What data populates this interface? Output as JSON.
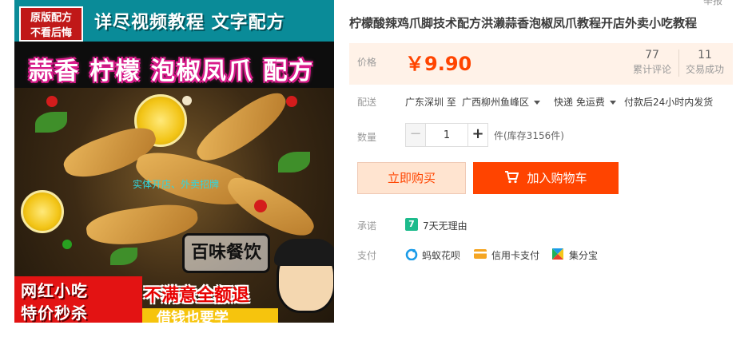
{
  "product_image": {
    "badge_line1": "原版配方",
    "badge_line2": "不看后悔",
    "headline": "详尽视频教程 文字配方",
    "banner": "蒜香 柠檬 泡椒凤爪 配方",
    "watermark": "实体开店、外卖招牌",
    "logo_text": "百味餐饮",
    "bottom_left_line1": "网红小吃",
    "bottom_left_line2": "特价秒杀",
    "bottom_right": "不满意全额退",
    "bottom_strip": "借钱也要学"
  },
  "header": {
    "report": "举报"
  },
  "title": "柠檬酸辣鸡爪脚技术配方洪濑蒜香泡椒凤爪教程开店外卖小吃教程",
  "price": {
    "label": "价格",
    "value": "￥9.90",
    "reviews_count": "77",
    "reviews_label": "累计评论",
    "deals_count": "11",
    "deals_label": "交易成功",
    "accent_color": "#ff4400"
  },
  "delivery": {
    "label": "配送",
    "from": "广东深圳 至",
    "to": "广西柳州鱼峰区",
    "shipping": "快递 免运费",
    "dispatch": "付款后24小时内发货"
  },
  "quantity": {
    "label": "数量",
    "value": "1",
    "minus": "−",
    "plus": "+",
    "stock": "件(库存3156件)"
  },
  "actions": {
    "buy_now": "立即购买",
    "add_to_cart": "加入购物车",
    "cart_icon": "cart-icon"
  },
  "promise": {
    "label": "承诺",
    "badge": "7",
    "text": "7天无理由"
  },
  "payment": {
    "label": "支付",
    "methods": [
      {
        "icon": "huabei-icon",
        "text": "蚂蚁花呗"
      },
      {
        "icon": "credit-card-icon",
        "text": "信用卡支付"
      },
      {
        "icon": "jifen-icon",
        "text": "集分宝"
      }
    ]
  }
}
